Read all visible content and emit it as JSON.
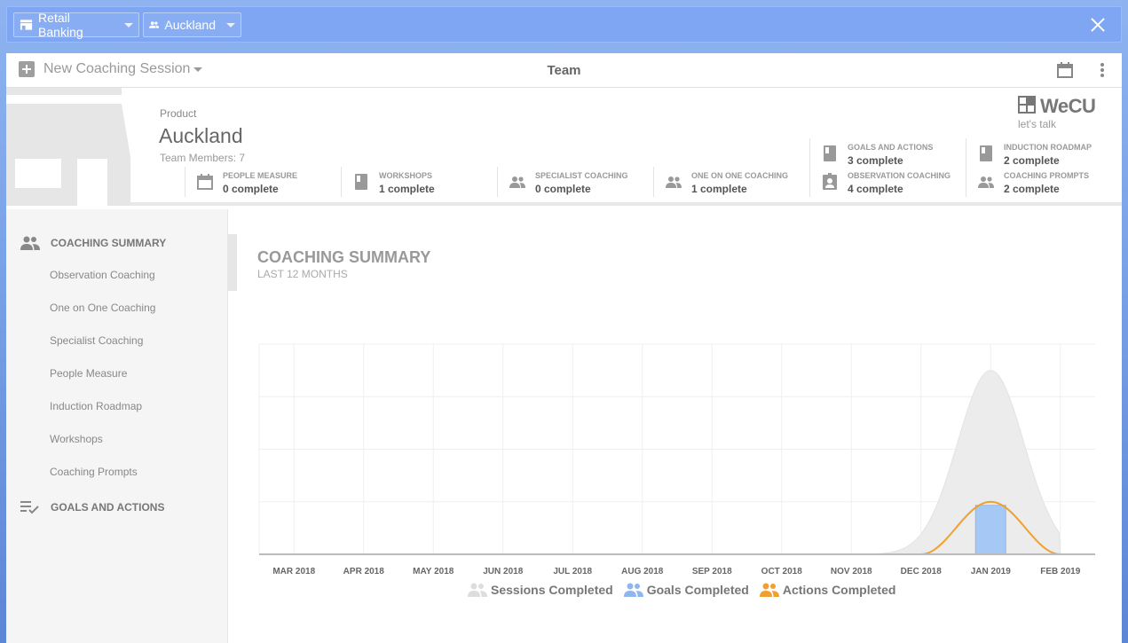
{
  "topbar": {
    "chips": [
      {
        "label": "Retail Banking",
        "icon": "store-icon"
      },
      {
        "label": "Auckland",
        "icon": "people-icon"
      }
    ]
  },
  "header": {
    "new_session_label": "New Coaching Session",
    "title": "Team"
  },
  "info": {
    "product_label": "Product",
    "product_name": "Auckland",
    "team_members": "Team Members: 7",
    "logo_text": "WeCU",
    "tagline": "let's talk",
    "stats": [
      {
        "label": "PEOPLE MEASURE",
        "value": "0 complete",
        "icon": "calendar-icon"
      },
      {
        "label": "WORKSHOPS",
        "value": "1 complete",
        "icon": "book-icon"
      },
      {
        "label": "SPECIALIST COACHING",
        "value": "0 complete",
        "icon": "people-icon"
      },
      {
        "label": "ONE ON ONE COACHING",
        "value": "1 complete",
        "icon": "people-icon"
      },
      {
        "label": "GOALS AND ACTIONS",
        "value": "3 complete",
        "icon": "book-icon"
      },
      {
        "label": "OBSERVATION COACHING",
        "value": "4 complete",
        "icon": "badge-icon"
      },
      {
        "label": "INDUCTION ROADMAP",
        "value": "2 complete",
        "icon": "book-icon"
      },
      {
        "label": "COACHING PROMPTS",
        "value": "2 complete",
        "icon": "people-icon"
      }
    ]
  },
  "sidebar": {
    "coaching_summary": "COACHING SUMMARY",
    "items": [
      "Observation Coaching",
      "One on One Coaching",
      "Specialist Coaching",
      "People Measure",
      "Induction Roadmap",
      "Workshops",
      "Coaching Prompts"
    ],
    "goals_and_actions": "GOALS AND ACTIONS"
  },
  "chart": {
    "title": "COACHING SUMMARY",
    "subtitle": "LAST 12 MONTHS"
  },
  "chart_data": {
    "type": "line",
    "categories": [
      "MAR 2018",
      "APR 2018",
      "MAY 2018",
      "JUN 2018",
      "JUL 2018",
      "AUG 2018",
      "SEP 2018",
      "OCT 2018",
      "NOV 2018",
      "DEC 2018",
      "JAN 2019",
      "FEB 2019"
    ],
    "series": [
      {
        "name": "Sessions Completed",
        "type": "area",
        "color": "#e0e0e0",
        "values": [
          0,
          0,
          0,
          0,
          0,
          0,
          0,
          0,
          0,
          0,
          7,
          0
        ]
      },
      {
        "name": "Goals Completed",
        "type": "bar",
        "color": "#a6c8f5",
        "values": [
          0,
          0,
          0,
          0,
          0,
          0,
          0,
          0,
          0,
          0,
          2,
          0
        ]
      },
      {
        "name": "Actions Completed",
        "type": "line",
        "color": "#f0a030",
        "values": [
          0,
          0,
          0,
          0,
          0,
          0,
          0,
          0,
          0,
          0,
          2,
          0
        ]
      }
    ],
    "ylim": [
      0,
      8
    ],
    "grid": true,
    "legend": "bottom"
  }
}
